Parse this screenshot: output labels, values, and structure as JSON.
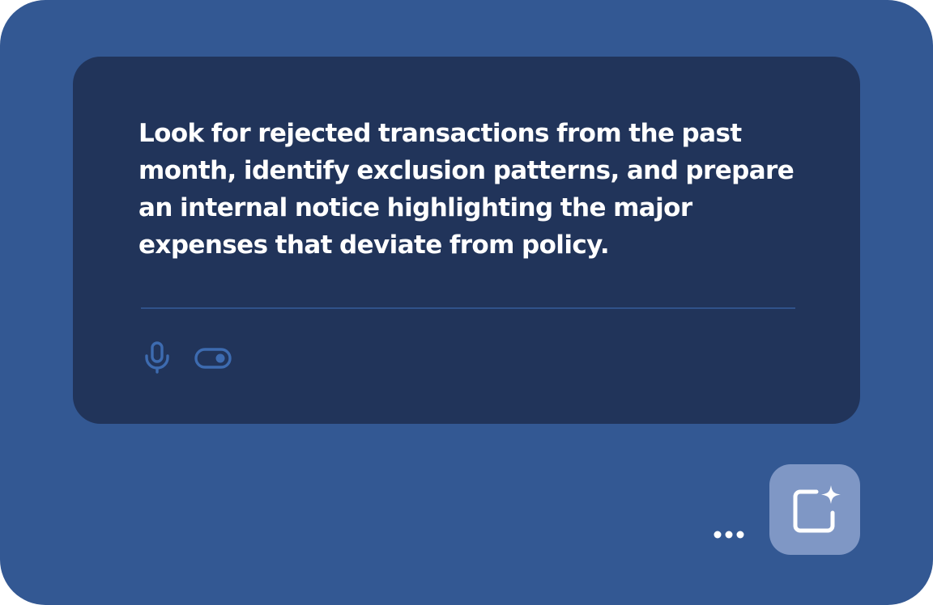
{
  "prompt": {
    "text": "Look for rejected transactions from the past month, identify exclusion patterns, and prepare an internal notice highlighting the major expenses that deviate from policy."
  },
  "toolbar": {
    "icons": [
      "microphone-icon",
      "toggle-switch-icon"
    ]
  },
  "actions": {
    "more_icon": "more-dots-icon",
    "ai_compose_icon": "ai-compose-sparkle-icon"
  },
  "colors": {
    "background": "#335893",
    "card": "#21345a",
    "divider": "#30528a",
    "icon_muted": "#3d6bb0",
    "ai_button": "#7f97c5",
    "text": "#ffffff"
  }
}
